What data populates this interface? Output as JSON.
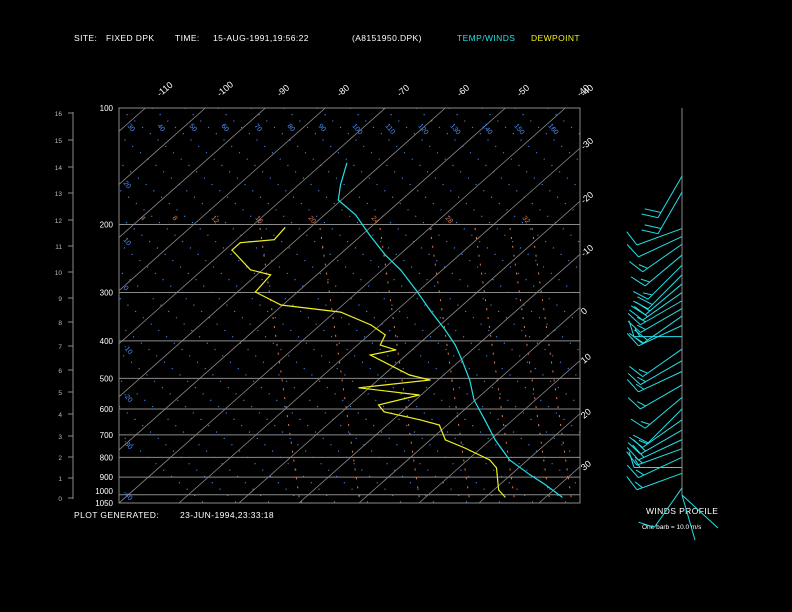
{
  "header": {
    "site_label": "SITE:",
    "site_value": "FIXED DPK",
    "time_label": "TIME:",
    "time_value": "15-AUG-1991,19:56:22",
    "file": "(A8151950.DPK)",
    "legend_temp": "TEMP/WINDS",
    "legend_dew": "DEWPOINT"
  },
  "footer": {
    "generated_label": "PLOT GENERATED:",
    "generated_value": "23-JUN-1994,23:33:18"
  },
  "winds_panel": {
    "title": "WINDS PROFILE",
    "note": "One barb = 10.0 m/s"
  },
  "colors": {
    "temp": "#22e0e8",
    "dewpoint": "#f0f020",
    "grid": "#8a8a8a",
    "adiabat": "#4a90ff",
    "mixing": "#e07a4a"
  },
  "chart_data": {
    "type": "line",
    "title": "Skew-T log-P sounding",
    "pressure_levels": [
      "100",
      "200",
      "300",
      "400",
      "500",
      "600",
      "700",
      "800",
      "900",
      "1000",
      "1050"
    ],
    "height_ticks_km": [
      "0",
      "1",
      "2",
      "3",
      "4",
      "5",
      "6",
      "7",
      "8",
      "9",
      "10",
      "11",
      "12",
      "13",
      "14",
      "15",
      "16"
    ],
    "top_isotherm_labels": [
      "-110",
      "-100",
      "-90",
      "-80",
      "-70",
      "-60",
      "-50",
      "-40"
    ],
    "right_isotherm_labels": [
      "-40",
      "-30",
      "-20",
      "-10",
      "0",
      "10",
      "20",
      "30"
    ],
    "dry_adiabat_top_labels": [
      "30",
      "40",
      "50",
      "60",
      "70",
      "80",
      "90",
      "100",
      "110",
      "120",
      "130",
      "140",
      "150",
      "160"
    ],
    "dry_adiabat_left_labels": [
      "20",
      "10",
      "0",
      "-10",
      "-20",
      "-30",
      "-40"
    ],
    "mixing_ratio_labels": [
      "4",
      "8",
      "12",
      "16",
      "20",
      "24",
      "28",
      "32"
    ],
    "ylim_hpa": [
      1050,
      100
    ],
    "series": [
      {
        "name": "TEMP",
        "points": [
          [
            139,
            -66
          ],
          [
            158,
            -63
          ],
          [
            173,
            -60.5
          ],
          [
            189,
            -54.8
          ],
          [
            213,
            -48.7
          ],
          [
            240,
            -42.3
          ],
          [
            262,
            -37
          ],
          [
            295,
            -30.7
          ],
          [
            333,
            -24.5
          ],
          [
            375,
            -18.2
          ],
          [
            410,
            -13.7
          ],
          [
            448,
            -9.8
          ],
          [
            505,
            -4.7
          ],
          [
            569,
            -0.2
          ],
          [
            640,
            5.3
          ],
          [
            721,
            10.8
          ],
          [
            813,
            17
          ],
          [
            888,
            23.2
          ],
          [
            943,
            27.7
          ],
          [
            1013,
            32.7
          ]
        ]
      },
      {
        "name": "DEWPOINT",
        "points": [
          [
            204,
            -64.2
          ],
          [
            219,
            -63.7
          ],
          [
            223,
            -68.8
          ],
          [
            233,
            -68.8
          ],
          [
            262,
            -62
          ],
          [
            270,
            -57.7
          ],
          [
            299,
            -57
          ],
          [
            323,
            -50.3
          ],
          [
            337,
            -39
          ],
          [
            364,
            -31.5
          ],
          [
            386,
            -27.3
          ],
          [
            410,
            -26.2
          ],
          [
            422,
            -22.7
          ],
          [
            435,
            -26
          ],
          [
            490,
            -15.7
          ],
          [
            505,
            -11.3
          ],
          [
            529,
            -21.7
          ],
          [
            552,
            -10.3
          ],
          [
            586,
            -15.2
          ],
          [
            610,
            -13
          ],
          [
            640,
            -5.5
          ],
          [
            660,
            -1.3
          ],
          [
            721,
            2.5
          ],
          [
            757,
            7.3
          ],
          [
            813,
            13.7
          ],
          [
            852,
            16.3
          ],
          [
            971,
            20.8
          ],
          [
            1013,
            23.2
          ]
        ]
      }
    ],
    "winds": [
      {
        "p": 150,
        "dir": 210,
        "spd": 20
      },
      {
        "p": 165,
        "dir": 210,
        "spd": 20
      },
      {
        "p": 205,
        "dir": 250,
        "spd": 10
      },
      {
        "p": 215,
        "dir": 245,
        "spd": 10
      },
      {
        "p": 225,
        "dir": 235,
        "spd": 15
      },
      {
        "p": 240,
        "dir": 230,
        "spd": 15
      },
      {
        "p": 255,
        "dir": 225,
        "spd": 15
      },
      {
        "p": 270,
        "dir": 225,
        "spd": 20
      },
      {
        "p": 285,
        "dir": 230,
        "spd": 20
      },
      {
        "p": 300,
        "dir": 235,
        "spd": 20
      },
      {
        "p": 315,
        "dir": 240,
        "spd": 15
      },
      {
        "p": 330,
        "dir": 240,
        "spd": 15
      },
      {
        "p": 345,
        "dir": 235,
        "spd": 20
      },
      {
        "p": 365,
        "dir": 245,
        "spd": 15
      },
      {
        "p": 390,
        "dir": 270,
        "spd": 15
      },
      {
        "p": 420,
        "dir": 235,
        "spd": 15
      },
      {
        "p": 450,
        "dir": 240,
        "spd": 15
      },
      {
        "p": 480,
        "dir": 245,
        "spd": 15
      },
      {
        "p": 520,
        "dir": 240,
        "spd": 15
      },
      {
        "p": 560,
        "dir": 230,
        "spd": 15
      },
      {
        "p": 600,
        "dir": 225,
        "spd": 10
      },
      {
        "p": 640,
        "dir": 235,
        "spd": 15
      },
      {
        "p": 680,
        "dir": 240,
        "spd": 20
      },
      {
        "p": 720,
        "dir": 245,
        "spd": 20
      },
      {
        "p": 760,
        "dir": 250,
        "spd": 15
      },
      {
        "p": 800,
        "dir": 245,
        "spd": 15
      },
      {
        "p": 850,
        "dir": 270,
        "spd": 15
      },
      {
        "p": 880,
        "dir": 250,
        "spd": 15
      },
      {
        "p": 960,
        "dir": 215,
        "spd": 10
      }
    ]
  }
}
